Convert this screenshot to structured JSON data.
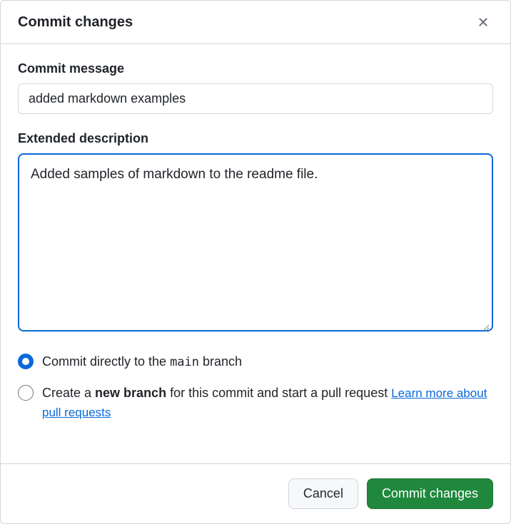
{
  "header": {
    "title": "Commit changes"
  },
  "commitMessage": {
    "label": "Commit message",
    "value": "added markdown examples"
  },
  "extendedDescription": {
    "label": "Extended description",
    "value": "Added samples of markdown to the readme file."
  },
  "radios": {
    "direct": {
      "prefix": "Commit directly to the ",
      "branch": "main",
      "suffix": " branch"
    },
    "newBranch": {
      "prefix": "Create a ",
      "bold": "new branch",
      "suffix": " for this commit and start a pull request ",
      "linkText": "Learn more about pull requests"
    }
  },
  "footer": {
    "cancel": "Cancel",
    "commit": "Commit changes"
  }
}
